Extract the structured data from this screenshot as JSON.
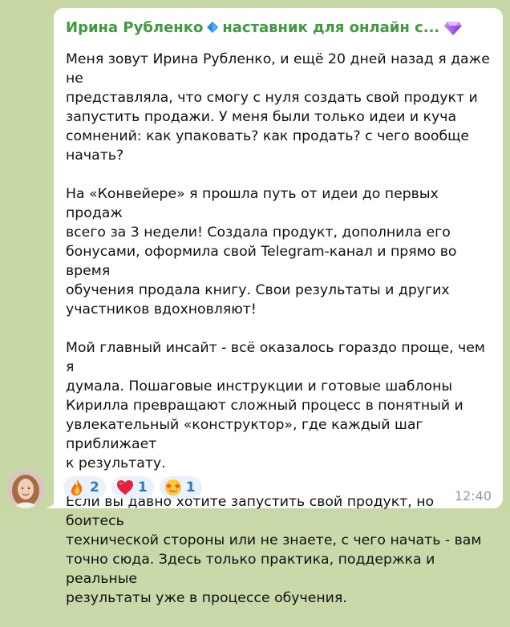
{
  "message": {
    "sender": "Ирина Рубленко",
    "sender_suffix": "наставник для онлайн с...",
    "paragraphs": [
      "Меня зовут Ирина Рубленко, и ещё 20 дней назад я даже не\nпредставляла, что смогу с нуля создать свой продукт и\nзапустить продажи. У меня были только идеи и куча\nсомнений: как упаковать? как продать? с чего вообще\nначать?",
      "На «Конвейере» я прошла путь от идеи до первых продаж\nвсего за 3 недели! Создала продукт, дополнила его\nбонусами, оформила свой Telegram-канал и прямо во время\nобучения продала книгу. Свои результаты и других\nучастников вдохновляют!",
      "Мой главный инсайт - всё оказалось гораздо проще, чем я\nдумала. Пошаговые инструкции и готовые шаблоны\nКирилла превращают сложный процесс в понятный и\nувлекательный «конструктор», где каждый шаг приближает\nк результату.",
      "Если вы давно хотите запустить свой продукт, но боитесь\nтехнической стороны или не знаете, с чего начать - вам\nточно сюда. Здесь только практика, поддержка и реальные\nрезультаты уже в процессе обучения."
    ],
    "reactions": [
      {
        "icon": "fire-icon",
        "count": "2"
      },
      {
        "icon": "heart-icon",
        "count": "1"
      },
      {
        "icon": "star-struck-icon",
        "count": "1"
      }
    ],
    "time": "12:40"
  },
  "colors": {
    "sender": "#3f9b3d",
    "reaction_bg": "#e9f2fb",
    "reaction_text": "#2f7ab8",
    "time": "#8d9aa6",
    "background": "#c7d8a6"
  }
}
